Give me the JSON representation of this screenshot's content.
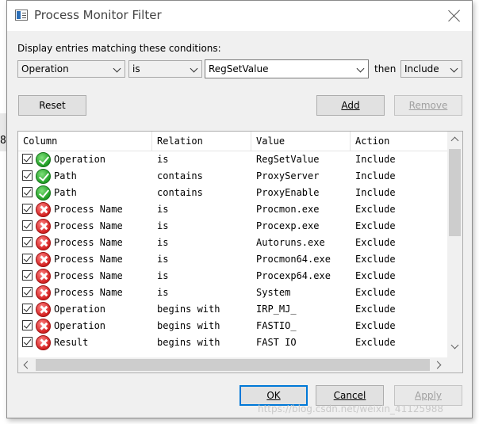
{
  "background_fragment": "8",
  "window": {
    "title": "Process Monitor Filter"
  },
  "condition_bar": {
    "label": "Display entries matching these conditions:",
    "column_value": "Operation",
    "relation_value": "is",
    "value_text": "RegSetValue",
    "then_label": "then",
    "action_value": "Include"
  },
  "buttons": {
    "reset": "Reset",
    "add": "Add",
    "remove": "Remove",
    "ok": "OK",
    "cancel": "Cancel",
    "apply": "Apply"
  },
  "table": {
    "headers": [
      "Column",
      "Relation",
      "Value",
      "Action"
    ],
    "rows": [
      {
        "column": "Operation",
        "relation": "is",
        "value": "RegSetValue",
        "action": "Include",
        "status": "include"
      },
      {
        "column": "Path",
        "relation": "contains",
        "value": "ProxyServer",
        "action": "Include",
        "status": "include"
      },
      {
        "column": "Path",
        "relation": "contains",
        "value": "ProxyEnable",
        "action": "Include",
        "status": "include"
      },
      {
        "column": "Process Name",
        "relation": "is",
        "value": "Procmon.exe",
        "action": "Exclude",
        "status": "exclude"
      },
      {
        "column": "Process Name",
        "relation": "is",
        "value": "Procexp.exe",
        "action": "Exclude",
        "status": "exclude"
      },
      {
        "column": "Process Name",
        "relation": "is",
        "value": "Autoruns.exe",
        "action": "Exclude",
        "status": "exclude"
      },
      {
        "column": "Process Name",
        "relation": "is",
        "value": "Procmon64.exe",
        "action": "Exclude",
        "status": "exclude"
      },
      {
        "column": "Process Name",
        "relation": "is",
        "value": "Procexp64.exe",
        "action": "Exclude",
        "status": "exclude"
      },
      {
        "column": "Process Name",
        "relation": "is",
        "value": "System",
        "action": "Exclude",
        "status": "exclude"
      },
      {
        "column": "Operation",
        "relation": "begins with",
        "value": "IRP_MJ_",
        "action": "Exclude",
        "status": "exclude"
      },
      {
        "column": "Operation",
        "relation": "begins with",
        "value": "FASTIO_",
        "action": "Exclude",
        "status": "exclude"
      },
      {
        "column": "Result",
        "relation": "begins with",
        "value": "FAST IO",
        "action": "Exclude",
        "status": "exclude"
      }
    ]
  },
  "watermark": "https://blog.csdn.net/weixin_41125988",
  "colors": {
    "include_icon": "#1f9d24",
    "exclude_icon": "#d31f1f",
    "default_button_border": "#0078d7"
  }
}
